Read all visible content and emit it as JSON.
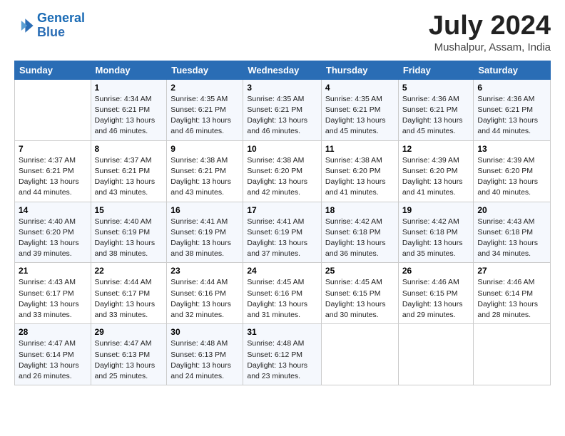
{
  "logo": {
    "line1": "General",
    "line2": "Blue"
  },
  "title": "July 2024",
  "location": "Mushalpur, Assam, India",
  "days_header": [
    "Sunday",
    "Monday",
    "Tuesday",
    "Wednesday",
    "Thursday",
    "Friday",
    "Saturday"
  ],
  "weeks": [
    [
      {
        "day": "",
        "info": ""
      },
      {
        "day": "1",
        "info": "Sunrise: 4:34 AM\nSunset: 6:21 PM\nDaylight: 13 hours\nand 46 minutes."
      },
      {
        "day": "2",
        "info": "Sunrise: 4:35 AM\nSunset: 6:21 PM\nDaylight: 13 hours\nand 46 minutes."
      },
      {
        "day": "3",
        "info": "Sunrise: 4:35 AM\nSunset: 6:21 PM\nDaylight: 13 hours\nand 46 minutes."
      },
      {
        "day": "4",
        "info": "Sunrise: 4:35 AM\nSunset: 6:21 PM\nDaylight: 13 hours\nand 45 minutes."
      },
      {
        "day": "5",
        "info": "Sunrise: 4:36 AM\nSunset: 6:21 PM\nDaylight: 13 hours\nand 45 minutes."
      },
      {
        "day": "6",
        "info": "Sunrise: 4:36 AM\nSunset: 6:21 PM\nDaylight: 13 hours\nand 44 minutes."
      }
    ],
    [
      {
        "day": "7",
        "info": "Sunrise: 4:37 AM\nSunset: 6:21 PM\nDaylight: 13 hours\nand 44 minutes."
      },
      {
        "day": "8",
        "info": "Sunrise: 4:37 AM\nSunset: 6:21 PM\nDaylight: 13 hours\nand 43 minutes."
      },
      {
        "day": "9",
        "info": "Sunrise: 4:38 AM\nSunset: 6:21 PM\nDaylight: 13 hours\nand 43 minutes."
      },
      {
        "day": "10",
        "info": "Sunrise: 4:38 AM\nSunset: 6:20 PM\nDaylight: 13 hours\nand 42 minutes."
      },
      {
        "day": "11",
        "info": "Sunrise: 4:38 AM\nSunset: 6:20 PM\nDaylight: 13 hours\nand 41 minutes."
      },
      {
        "day": "12",
        "info": "Sunrise: 4:39 AM\nSunset: 6:20 PM\nDaylight: 13 hours\nand 41 minutes."
      },
      {
        "day": "13",
        "info": "Sunrise: 4:39 AM\nSunset: 6:20 PM\nDaylight: 13 hours\nand 40 minutes."
      }
    ],
    [
      {
        "day": "14",
        "info": "Sunrise: 4:40 AM\nSunset: 6:20 PM\nDaylight: 13 hours\nand 39 minutes."
      },
      {
        "day": "15",
        "info": "Sunrise: 4:40 AM\nSunset: 6:19 PM\nDaylight: 13 hours\nand 38 minutes."
      },
      {
        "day": "16",
        "info": "Sunrise: 4:41 AM\nSunset: 6:19 PM\nDaylight: 13 hours\nand 38 minutes."
      },
      {
        "day": "17",
        "info": "Sunrise: 4:41 AM\nSunset: 6:19 PM\nDaylight: 13 hours\nand 37 minutes."
      },
      {
        "day": "18",
        "info": "Sunrise: 4:42 AM\nSunset: 6:18 PM\nDaylight: 13 hours\nand 36 minutes."
      },
      {
        "day": "19",
        "info": "Sunrise: 4:42 AM\nSunset: 6:18 PM\nDaylight: 13 hours\nand 35 minutes."
      },
      {
        "day": "20",
        "info": "Sunrise: 4:43 AM\nSunset: 6:18 PM\nDaylight: 13 hours\nand 34 minutes."
      }
    ],
    [
      {
        "day": "21",
        "info": "Sunrise: 4:43 AM\nSunset: 6:17 PM\nDaylight: 13 hours\nand 33 minutes."
      },
      {
        "day": "22",
        "info": "Sunrise: 4:44 AM\nSunset: 6:17 PM\nDaylight: 13 hours\nand 33 minutes."
      },
      {
        "day": "23",
        "info": "Sunrise: 4:44 AM\nSunset: 6:16 PM\nDaylight: 13 hours\nand 32 minutes."
      },
      {
        "day": "24",
        "info": "Sunrise: 4:45 AM\nSunset: 6:16 PM\nDaylight: 13 hours\nand 31 minutes."
      },
      {
        "day": "25",
        "info": "Sunrise: 4:45 AM\nSunset: 6:15 PM\nDaylight: 13 hours\nand 30 minutes."
      },
      {
        "day": "26",
        "info": "Sunrise: 4:46 AM\nSunset: 6:15 PM\nDaylight: 13 hours\nand 29 minutes."
      },
      {
        "day": "27",
        "info": "Sunrise: 4:46 AM\nSunset: 6:14 PM\nDaylight: 13 hours\nand 28 minutes."
      }
    ],
    [
      {
        "day": "28",
        "info": "Sunrise: 4:47 AM\nSunset: 6:14 PM\nDaylight: 13 hours\nand 26 minutes."
      },
      {
        "day": "29",
        "info": "Sunrise: 4:47 AM\nSunset: 6:13 PM\nDaylight: 13 hours\nand 25 minutes."
      },
      {
        "day": "30",
        "info": "Sunrise: 4:48 AM\nSunset: 6:13 PM\nDaylight: 13 hours\nand 24 minutes."
      },
      {
        "day": "31",
        "info": "Sunrise: 4:48 AM\nSunset: 6:12 PM\nDaylight: 13 hours\nand 23 minutes."
      },
      {
        "day": "",
        "info": ""
      },
      {
        "day": "",
        "info": ""
      },
      {
        "day": "",
        "info": ""
      }
    ]
  ]
}
